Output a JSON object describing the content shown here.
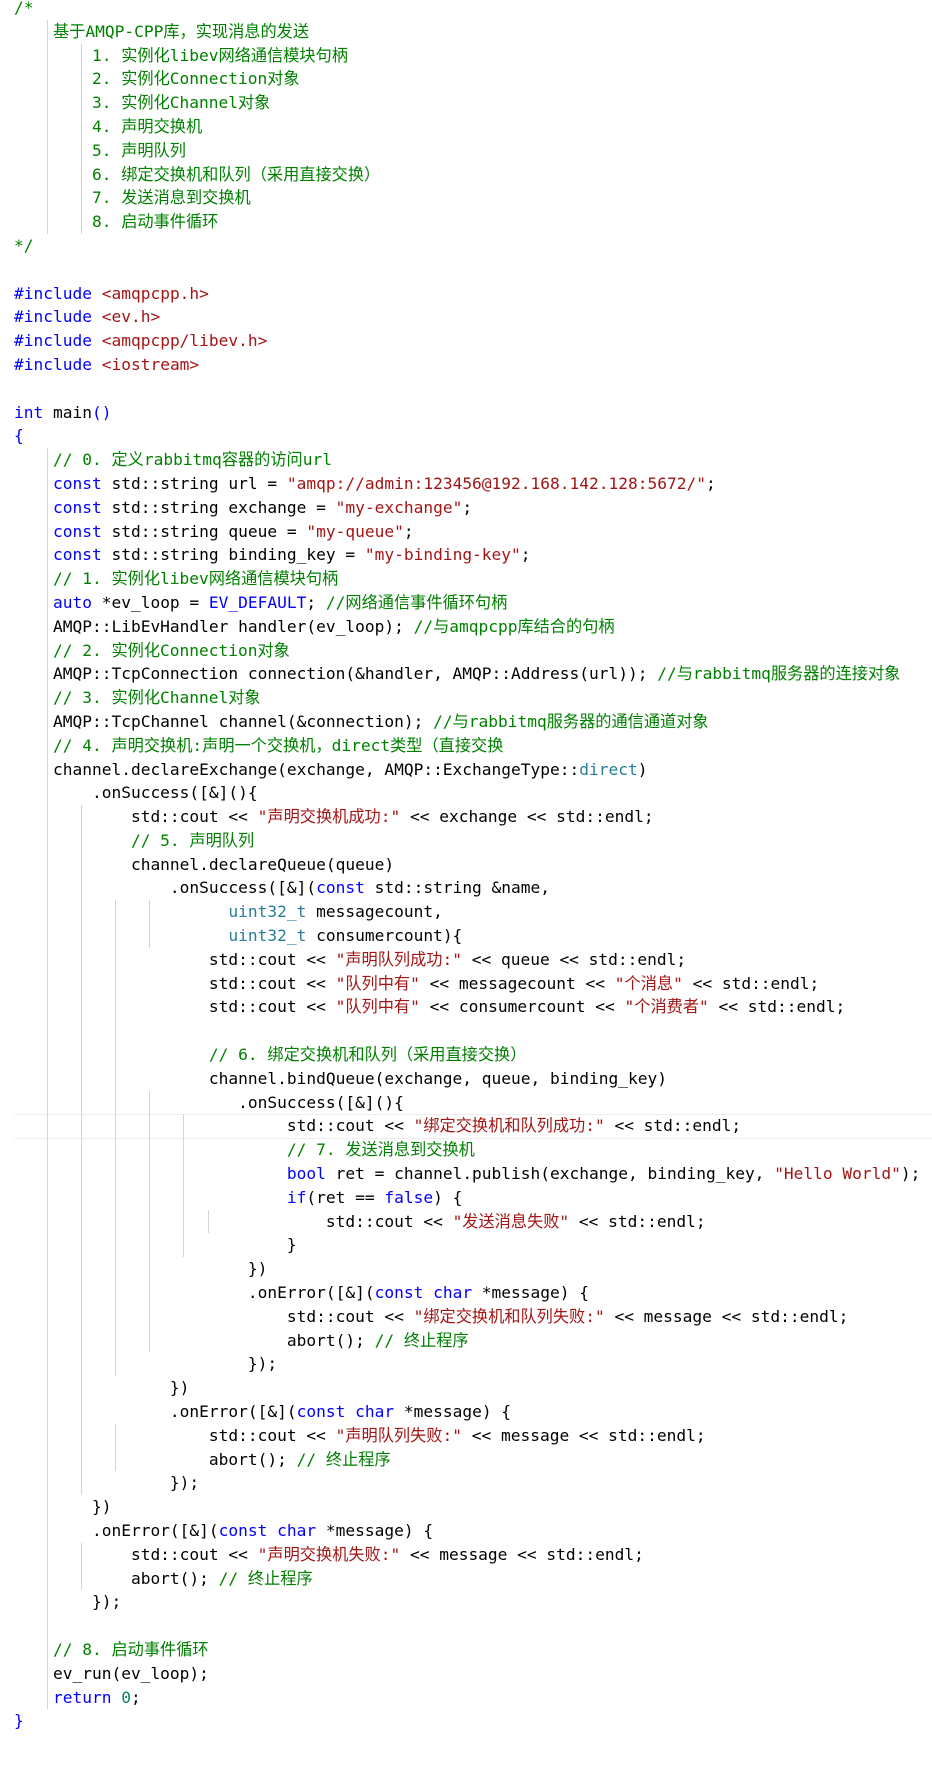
{
  "colors": {
    "background": "#ffffff",
    "comment": "#008000",
    "keyword": "#0000ff",
    "type": "#267f99",
    "string": "#a31515",
    "number": "#098658",
    "default": "#000000"
  },
  "lines": [
    {
      "guides": [],
      "tokens": [
        {
          "t": "/*",
          "c": "comment"
        }
      ]
    },
    {
      "guides": [
        1
      ],
      "tokens": [
        {
          "t": "    基于AMQP-CPP库，实现消息的发送",
          "c": "comment"
        }
      ]
    },
    {
      "guides": [
        1,
        2
      ],
      "tokens": [
        {
          "t": "        1. 实例化libev网络通信模块句柄",
          "c": "comment"
        }
      ]
    },
    {
      "guides": [
        1,
        2
      ],
      "tokens": [
        {
          "t": "        2. 实例化Connection对象",
          "c": "comment"
        }
      ]
    },
    {
      "guides": [
        1,
        2
      ],
      "tokens": [
        {
          "t": "        3. 实例化Channel对象",
          "c": "comment"
        }
      ]
    },
    {
      "guides": [
        1,
        2
      ],
      "tokens": [
        {
          "t": "        4. 声明交换机",
          "c": "comment"
        }
      ]
    },
    {
      "guides": [
        1,
        2
      ],
      "tokens": [
        {
          "t": "        5. 声明队列",
          "c": "comment"
        }
      ]
    },
    {
      "guides": [
        1,
        2
      ],
      "tokens": [
        {
          "t": "        6. 绑定交换机和队列（采用直接交换）",
          "c": "comment"
        }
      ]
    },
    {
      "guides": [
        1,
        2
      ],
      "tokens": [
        {
          "t": "        7. 发送消息到交换机",
          "c": "comment"
        }
      ]
    },
    {
      "guides": [
        1,
        2
      ],
      "tokens": [
        {
          "t": "        8. 启动事件循环",
          "c": "comment"
        }
      ]
    },
    {
      "guides": [],
      "tokens": [
        {
          "t": "*/",
          "c": "comment"
        }
      ]
    },
    {
      "guides": [],
      "tokens": []
    },
    {
      "guides": [],
      "tokens": [
        {
          "t": "#include",
          "c": "macro"
        },
        {
          "t": " ",
          "c": "default"
        },
        {
          "t": "<amqpcpp.h>",
          "c": "string"
        }
      ]
    },
    {
      "guides": [],
      "tokens": [
        {
          "t": "#include",
          "c": "macro"
        },
        {
          "t": " ",
          "c": "default"
        },
        {
          "t": "<ev.h>",
          "c": "string"
        }
      ]
    },
    {
      "guides": [],
      "tokens": [
        {
          "t": "#include",
          "c": "macro"
        },
        {
          "t": " ",
          "c": "default"
        },
        {
          "t": "<amqpcpp/libev.h>",
          "c": "string"
        }
      ]
    },
    {
      "guides": [],
      "tokens": [
        {
          "t": "#include",
          "c": "macro"
        },
        {
          "t": " ",
          "c": "default"
        },
        {
          "t": "<iostream>",
          "c": "string"
        }
      ]
    },
    {
      "guides": [],
      "tokens": []
    },
    {
      "guides": [],
      "tokens": [
        {
          "t": "int",
          "c": "keyword"
        },
        {
          "t": " main",
          "c": "default"
        },
        {
          "t": "()",
          "c": "keyword"
        }
      ]
    },
    {
      "guides": [],
      "tokens": [
        {
          "t": "{",
          "c": "keyword"
        }
      ]
    },
    {
      "guides": [
        1
      ],
      "tokens": [
        {
          "t": "    // 0. 定义rabbitmq容器的访问url",
          "c": "comment"
        }
      ]
    },
    {
      "guides": [
        1
      ],
      "tokens": [
        {
          "t": "    ",
          "c": "default"
        },
        {
          "t": "const",
          "c": "keyword"
        },
        {
          "t": " std::string url = ",
          "c": "default"
        },
        {
          "t": "\"amqp://admin:123456@192.168.142.128:5672/\"",
          "c": "string"
        },
        {
          "t": ";",
          "c": "default"
        }
      ]
    },
    {
      "guides": [
        1
      ],
      "tokens": [
        {
          "t": "    ",
          "c": "default"
        },
        {
          "t": "const",
          "c": "keyword"
        },
        {
          "t": " std::string exchange = ",
          "c": "default"
        },
        {
          "t": "\"my-exchange\"",
          "c": "string"
        },
        {
          "t": ";",
          "c": "default"
        }
      ]
    },
    {
      "guides": [
        1
      ],
      "tokens": [
        {
          "t": "    ",
          "c": "default"
        },
        {
          "t": "const",
          "c": "keyword"
        },
        {
          "t": " std::string queue = ",
          "c": "default"
        },
        {
          "t": "\"my-queue\"",
          "c": "string"
        },
        {
          "t": ";",
          "c": "default"
        }
      ]
    },
    {
      "guides": [
        1
      ],
      "tokens": [
        {
          "t": "    ",
          "c": "default"
        },
        {
          "t": "const",
          "c": "keyword"
        },
        {
          "t": " std::string binding_key = ",
          "c": "default"
        },
        {
          "t": "\"my-binding-key\"",
          "c": "string"
        },
        {
          "t": ";",
          "c": "default"
        }
      ]
    },
    {
      "guides": [
        1
      ],
      "tokens": [
        {
          "t": "    // 1. 实例化libev网络通信模块句柄",
          "c": "comment"
        }
      ]
    },
    {
      "guides": [
        1
      ],
      "tokens": [
        {
          "t": "    ",
          "c": "default"
        },
        {
          "t": "auto",
          "c": "keyword"
        },
        {
          "t": " *ev_loop = ",
          "c": "default"
        },
        {
          "t": "EV_DEFAULT",
          "c": "macro"
        },
        {
          "t": "; ",
          "c": "default"
        },
        {
          "t": "//网络通信事件循环句柄",
          "c": "comment"
        }
      ]
    },
    {
      "guides": [
        1
      ],
      "tokens": [
        {
          "t": "    AMQP::LibEvHandler handler(ev_loop); ",
          "c": "default"
        },
        {
          "t": "//与amqpcpp库结合的句柄",
          "c": "comment"
        }
      ]
    },
    {
      "guides": [
        1
      ],
      "tokens": [
        {
          "t": "    // 2. 实例化Connection对象",
          "c": "comment"
        }
      ]
    },
    {
      "guides": [
        1
      ],
      "tokens": [
        {
          "t": "    AMQP::TcpConnection connection(&handler, AMQP::Address(url)); ",
          "c": "default"
        },
        {
          "t": "//与rabbitmq服务器的连接对象",
          "c": "comment"
        }
      ]
    },
    {
      "guides": [
        1
      ],
      "tokens": [
        {
          "t": "    // 3. 实例化Channel对象",
          "c": "comment"
        }
      ]
    },
    {
      "guides": [
        1
      ],
      "tokens": [
        {
          "t": "    AMQP::TcpChannel channel(&connection); ",
          "c": "default"
        },
        {
          "t": "//与rabbitmq服务器的通信通道对象",
          "c": "comment"
        }
      ]
    },
    {
      "guides": [
        1
      ],
      "tokens": [
        {
          "t": "    // 4. 声明交换机:声明一个交换机，direct类型（直接交换",
          "c": "comment"
        }
      ]
    },
    {
      "guides": [
        1
      ],
      "tokens": [
        {
          "t": "    channel.declareExchange(exchange, AMQP::ExchangeType::",
          "c": "default"
        },
        {
          "t": "direct",
          "c": "type"
        },
        {
          "t": ")",
          "c": "default"
        }
      ]
    },
    {
      "guides": [
        1
      ],
      "tokens": [
        {
          "t": "        .onSuccess([&](){",
          "c": "default"
        }
      ]
    },
    {
      "guides": [
        1,
        2
      ],
      "tokens": [
        {
          "t": "            std::cout << ",
          "c": "default"
        },
        {
          "t": "\"声明交换机成功:\"",
          "c": "string"
        },
        {
          "t": " << exchange << std::endl;",
          "c": "default"
        }
      ]
    },
    {
      "guides": [
        1,
        2
      ],
      "tokens": [
        {
          "t": "            // 5. 声明队列",
          "c": "comment"
        }
      ]
    },
    {
      "guides": [
        1,
        2
      ],
      "tokens": [
        {
          "t": "            channel.declareQueue(queue)",
          "c": "default"
        }
      ]
    },
    {
      "guides": [
        1,
        2
      ],
      "tokens": [
        {
          "t": "                .onSuccess([&](",
          "c": "default"
        },
        {
          "t": "const",
          "c": "keyword"
        },
        {
          "t": " std::string &name,",
          "c": "default"
        }
      ]
    },
    {
      "guides": [
        1,
        2,
        3,
        4
      ],
      "tokens": [
        {
          "t": "                      ",
          "c": "default"
        },
        {
          "t": "uint32_t",
          "c": "type"
        },
        {
          "t": " messagecount,",
          "c": "default"
        }
      ]
    },
    {
      "guides": [
        1,
        2,
        3,
        4
      ],
      "tokens": [
        {
          "t": "                      ",
          "c": "default"
        },
        {
          "t": "uint32_t",
          "c": "type"
        },
        {
          "t": " consumercount){",
          "c": "default"
        }
      ]
    },
    {
      "guides": [
        1,
        2,
        3
      ],
      "tokens": [
        {
          "t": "                    std::cout << ",
          "c": "default"
        },
        {
          "t": "\"声明队列成功:\"",
          "c": "string"
        },
        {
          "t": " << queue << std::endl;",
          "c": "default"
        }
      ]
    },
    {
      "guides": [
        1,
        2,
        3
      ],
      "tokens": [
        {
          "t": "                    std::cout << ",
          "c": "default"
        },
        {
          "t": "\"队列中有\"",
          "c": "string"
        },
        {
          "t": " << messagecount << ",
          "c": "default"
        },
        {
          "t": "\"个消息\"",
          "c": "string"
        },
        {
          "t": " << std::endl;",
          "c": "default"
        }
      ]
    },
    {
      "guides": [
        1,
        2,
        3
      ],
      "tokens": [
        {
          "t": "                    std::cout << ",
          "c": "default"
        },
        {
          "t": "\"队列中有\"",
          "c": "string"
        },
        {
          "t": " << consumercount << ",
          "c": "default"
        },
        {
          "t": "\"个消费者\"",
          "c": "string"
        },
        {
          "t": " << std::endl;",
          "c": "default"
        }
      ]
    },
    {
      "guides": [
        1,
        2,
        3
      ],
      "tokens": []
    },
    {
      "guides": [
        1,
        2,
        3
      ],
      "tokens": [
        {
          "t": "                    // 6. 绑定交换机和队列（采用直接交换）",
          "c": "comment"
        }
      ]
    },
    {
      "guides": [
        1,
        2,
        3
      ],
      "tokens": [
        {
          "t": "                    channel.bindQueue(exchange, queue, binding_key)",
          "c": "default"
        }
      ]
    },
    {
      "guides": [
        1,
        2,
        3,
        4
      ],
      "tokens": [
        {
          "t": "                       .onSuccess([&](){",
          "c": "default"
        }
      ]
    },
    {
      "guides": [
        1,
        2,
        3,
        4,
        5
      ],
      "tokens": [
        {
          "t": "                            std::cout << ",
          "c": "default"
        },
        {
          "t": "\"绑定交换机和队列成功:\"",
          "c": "string"
        },
        {
          "t": " << std::endl;",
          "c": "default"
        }
      ]
    },
    {
      "guides": [
        1,
        2,
        3,
        4,
        5
      ],
      "tokens": [
        {
          "t": "                            // 7. 发送消息到交换机",
          "c": "comment"
        }
      ]
    },
    {
      "guides": [
        1,
        2,
        3,
        4,
        5
      ],
      "tokens": [
        {
          "t": "                            ",
          "c": "default"
        },
        {
          "t": "bool",
          "c": "keyword"
        },
        {
          "t": " ret = channel.publish(exchange, binding_key, ",
          "c": "default"
        },
        {
          "t": "\"Hello World\"",
          "c": "string"
        },
        {
          "t": ");",
          "c": "default"
        }
      ]
    },
    {
      "guides": [
        1,
        2,
        3,
        4,
        5
      ],
      "tokens": [
        {
          "t": "                            ",
          "c": "default"
        },
        {
          "t": "if",
          "c": "keyword"
        },
        {
          "t": "(ret == ",
          "c": "default"
        },
        {
          "t": "false",
          "c": "keyword"
        },
        {
          "t": ") {",
          "c": "default"
        }
      ]
    },
    {
      "guides": [
        1,
        2,
        3,
        4,
        5,
        6
      ],
      "tokens": [
        {
          "t": "                                std::cout << ",
          "c": "default"
        },
        {
          "t": "\"发送消息失败\"",
          "c": "string"
        },
        {
          "t": " << std::endl;",
          "c": "default"
        }
      ]
    },
    {
      "guides": [
        1,
        2,
        3,
        4,
        5
      ],
      "tokens": [
        {
          "t": "                            }",
          "c": "default"
        }
      ]
    },
    {
      "guides": [
        1,
        2,
        3,
        4
      ],
      "tokens": [
        {
          "t": "                        })",
          "c": "default"
        }
      ]
    },
    {
      "guides": [
        1,
        2,
        3,
        4
      ],
      "tokens": [
        {
          "t": "                        .onError([&](",
          "c": "default"
        },
        {
          "t": "const",
          "c": "keyword"
        },
        {
          "t": " ",
          "c": "default"
        },
        {
          "t": "char",
          "c": "keyword"
        },
        {
          "t": " *message) {",
          "c": "default"
        }
      ]
    },
    {
      "guides": [
        1,
        2,
        3,
        4
      ],
      "tokens": [
        {
          "t": "                            std::cout << ",
          "c": "default"
        },
        {
          "t": "\"绑定交换机和队列失败:\"",
          "c": "string"
        },
        {
          "t": " << message << std::endl;",
          "c": "default"
        }
      ]
    },
    {
      "guides": [
        1,
        2,
        3,
        4
      ],
      "tokens": [
        {
          "t": "                            abort(); ",
          "c": "default"
        },
        {
          "t": "// 终止程序",
          "c": "comment"
        }
      ]
    },
    {
      "guides": [
        1,
        2,
        3
      ],
      "tokens": [
        {
          "t": "                        });",
          "c": "default"
        }
      ]
    },
    {
      "guides": [
        1,
        2
      ],
      "tokens": [
        {
          "t": "                })",
          "c": "default"
        }
      ]
    },
    {
      "guides": [
        1,
        2
      ],
      "tokens": [
        {
          "t": "                .onError([&](",
          "c": "default"
        },
        {
          "t": "const",
          "c": "keyword"
        },
        {
          "t": " ",
          "c": "default"
        },
        {
          "t": "char",
          "c": "keyword"
        },
        {
          "t": " *message) {",
          "c": "default"
        }
      ]
    },
    {
      "guides": [
        1,
        2,
        3
      ],
      "tokens": [
        {
          "t": "                    std::cout << ",
          "c": "default"
        },
        {
          "t": "\"声明队列失败:\"",
          "c": "string"
        },
        {
          "t": " << message << std::endl;",
          "c": "default"
        }
      ]
    },
    {
      "guides": [
        1,
        2,
        3
      ],
      "tokens": [
        {
          "t": "                    abort(); ",
          "c": "default"
        },
        {
          "t": "// 终止程序",
          "c": "comment"
        }
      ]
    },
    {
      "guides": [
        1,
        2
      ],
      "tokens": [
        {
          "t": "                });",
          "c": "default"
        }
      ]
    },
    {
      "guides": [
        1
      ],
      "tokens": [
        {
          "t": "        })",
          "c": "default"
        }
      ]
    },
    {
      "guides": [
        1
      ],
      "tokens": [
        {
          "t": "        .onError([&](",
          "c": "default"
        },
        {
          "t": "const",
          "c": "keyword"
        },
        {
          "t": " ",
          "c": "default"
        },
        {
          "t": "char",
          "c": "keyword"
        },
        {
          "t": " *message) {",
          "c": "default"
        }
      ]
    },
    {
      "guides": [
        1,
        2
      ],
      "tokens": [
        {
          "t": "            std::cout << ",
          "c": "default"
        },
        {
          "t": "\"声明交换机失败:\"",
          "c": "string"
        },
        {
          "t": " << message << std::endl;",
          "c": "default"
        }
      ]
    },
    {
      "guides": [
        1,
        2
      ],
      "tokens": [
        {
          "t": "            abort(); ",
          "c": "default"
        },
        {
          "t": "// 终止程序",
          "c": "comment"
        }
      ]
    },
    {
      "guides": [
        1
      ],
      "tokens": [
        {
          "t": "        });",
          "c": "default"
        }
      ]
    },
    {
      "guides": [
        1
      ],
      "tokens": []
    },
    {
      "guides": [
        1
      ],
      "tokens": [
        {
          "t": "    // 8. 启动事件循环",
          "c": "comment"
        }
      ]
    },
    {
      "guides": [
        1
      ],
      "tokens": [
        {
          "t": "    ev_run(ev_loop);",
          "c": "default"
        }
      ]
    },
    {
      "guides": [
        1
      ],
      "tokens": [
        {
          "t": "    ",
          "c": "default"
        },
        {
          "t": "return",
          "c": "keyword"
        },
        {
          "t": " ",
          "c": "default"
        },
        {
          "t": "0",
          "c": "number"
        },
        {
          "t": ";",
          "c": "default"
        }
      ]
    },
    {
      "guides": [],
      "tokens": [
        {
          "t": "}",
          "c": "keyword"
        }
      ]
    }
  ]
}
